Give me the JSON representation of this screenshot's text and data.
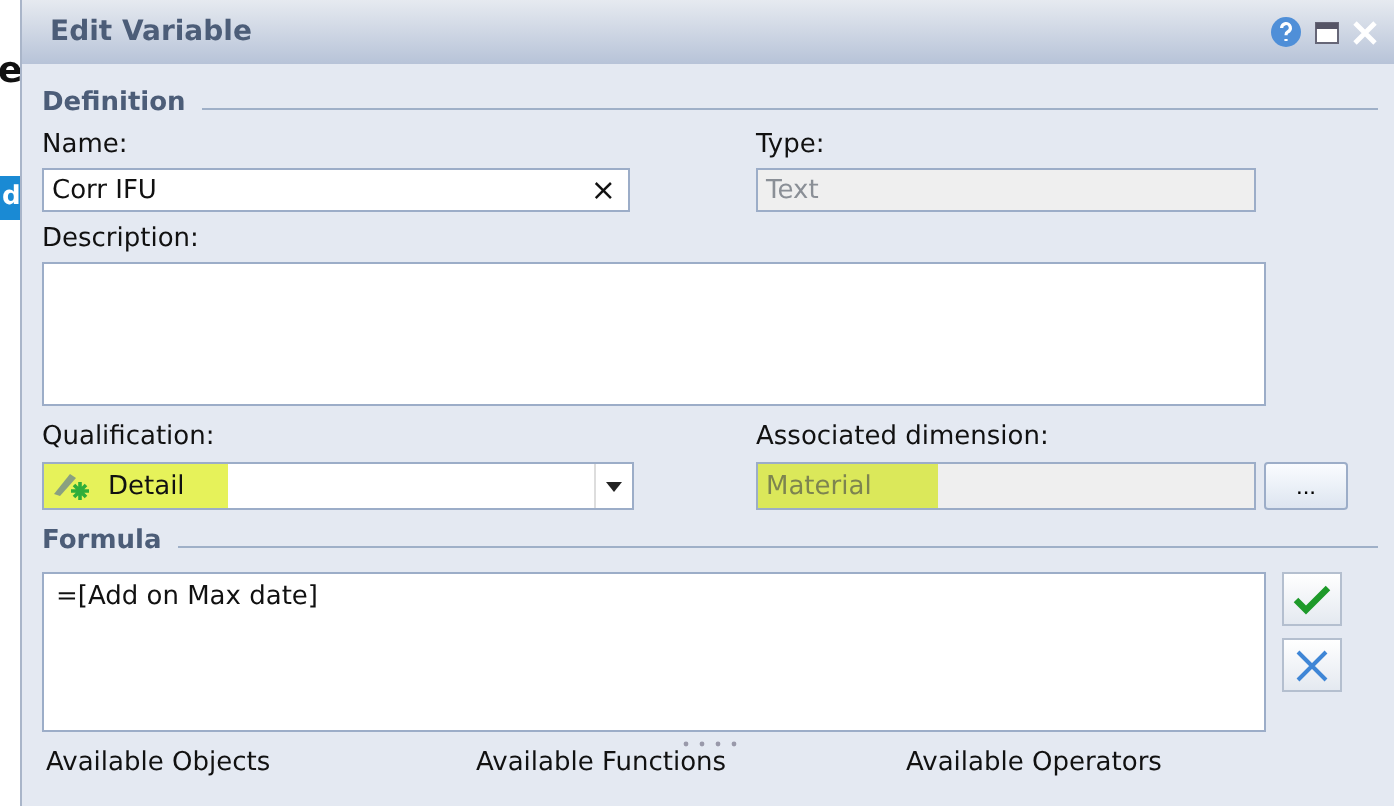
{
  "background_page": {
    "heading": "e",
    "button": "d"
  },
  "window": {
    "title": "Edit Variable"
  },
  "definition": {
    "title": "Definition",
    "name": {
      "label": "Name:",
      "value": "Corr IFU",
      "clear": "×"
    },
    "type": {
      "label": "Type:",
      "value": "Text",
      "disabled": true
    },
    "description": {
      "label": "Description:"
    },
    "qualification": {
      "label": "Qualification:",
      "value": "Detail",
      "highlighted": true
    },
    "associated_dimension": {
      "label": "Associated dimension:",
      "value": "Material",
      "disabled": true,
      "highlighted": true,
      "button": "..."
    }
  },
  "formula": {
    "title": "Formula",
    "value": "=[Add on Max date]"
  },
  "bottom_tabs": [
    "Available Objects",
    "Available Functions",
    "Available Operators"
  ]
}
